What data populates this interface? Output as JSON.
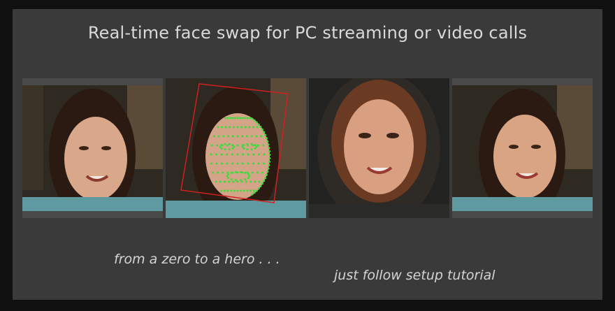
{
  "title": "Real-time face swap for PC streaming or video calls",
  "panels": [
    {
      "name": "source-face-image",
      "kind": "original"
    },
    {
      "name": "landmark-detection-image",
      "kind": "landmarks"
    },
    {
      "name": "generated-face-image",
      "kind": "generated"
    },
    {
      "name": "swapped-result-image",
      "kind": "result"
    }
  ],
  "captions": {
    "left": "from a zero to a hero . . .",
    "right": "just follow setup tutorial"
  },
  "colors": {
    "background": "#101010",
    "frame": "#3a3a3a",
    "text": "#d9d9d9",
    "landmark": "#3ddc3d",
    "bbox": "#d02020"
  }
}
